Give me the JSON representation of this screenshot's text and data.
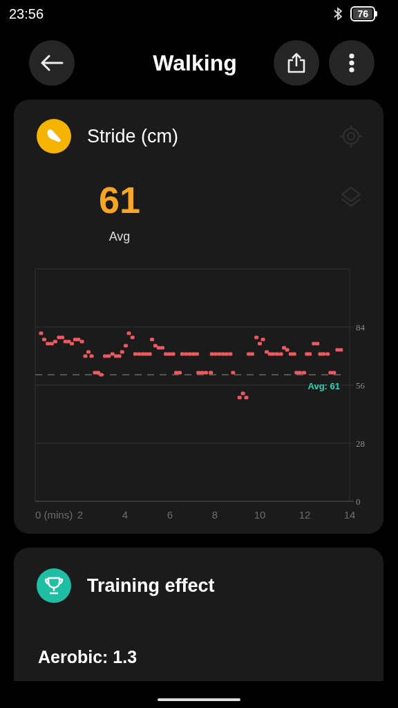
{
  "status_bar": {
    "time": "23:56",
    "battery": "76"
  },
  "header": {
    "title": "Walking"
  },
  "stride_card": {
    "title": "Stride (cm)",
    "value": "61",
    "value_label": "Avg",
    "chart_data": {
      "type": "scatter",
      "xlim": [
        0,
        14
      ],
      "ylim": [
        0,
        112
      ],
      "xticks": [
        {
          "value": 0,
          "label": "0 (mins)"
        },
        2,
        4,
        6,
        8,
        10,
        12,
        14
      ],
      "yticks": [
        0,
        28,
        56,
        84
      ],
      "x": [
        0.26,
        0.4,
        0.56,
        0.73,
        0.89,
        1.06,
        1.2,
        1.35,
        1.49,
        1.63,
        1.78,
        1.92,
        2.08,
        2.23,
        2.37,
        2.51,
        2.66,
        2.8,
        2.94,
        3.11,
        3.27,
        3.44,
        3.6,
        3.74,
        3.87,
        4.03,
        4.17,
        4.33,
        4.46,
        4.63,
        4.8,
        4.95,
        5.1,
        5.2,
        5.35,
        5.5,
        5.66,
        5.82,
        5.98,
        6.14,
        6.28,
        6.43,
        6.55,
        6.72,
        6.88,
        7.05,
        7.2,
        7.27,
        7.43,
        7.6,
        7.82,
        7.87,
        8.03,
        8.2,
        8.36,
        8.52,
        8.69,
        8.81,
        9.1,
        9.25,
        9.4,
        9.51,
        9.66,
        9.85,
        10.0,
        10.14,
        10.31,
        10.45,
        10.6,
        10.77,
        10.94,
        11.08,
        11.22,
        11.38,
        11.53,
        11.64,
        11.78,
        11.97,
        12.1,
        12.22,
        12.41,
        12.56,
        12.69,
        12.83,
        13.02,
        13.15,
        13.3,
        13.46,
        13.61
      ],
      "series": [
        {
          "color": "#ee5a60",
          "values": [
            81,
            78,
            76,
            76,
            77,
            79,
            79,
            77,
            77,
            76,
            78,
            78,
            77,
            70,
            72,
            70,
            62,
            62,
            61,
            70,
            70,
            71,
            70,
            70,
            72,
            75,
            81,
            79,
            71,
            71,
            71,
            71,
            71,
            78,
            75,
            74,
            74,
            71,
            71,
            71,
            62,
            62,
            71,
            71,
            71,
            71,
            71,
            62,
            62,
            62,
            62,
            71,
            71,
            71,
            71,
            71,
            71,
            62,
            50,
            52,
            50,
            71,
            71,
            79,
            76,
            78,
            72,
            71,
            71,
            71,
            71,
            74,
            73,
            71,
            71,
            62,
            62,
            62,
            71,
            71,
            76,
            76,
            71,
            71,
            71,
            62,
            62,
            73,
            73
          ]
        }
      ],
      "grid": true,
      "ref_lines": [
        {
          "axis": "y",
          "value": 61,
          "label": "Avg: 61"
        }
      ]
    }
  },
  "training_card": {
    "title": "Training effect",
    "aerobic": "Aerobic: 1.3"
  }
}
